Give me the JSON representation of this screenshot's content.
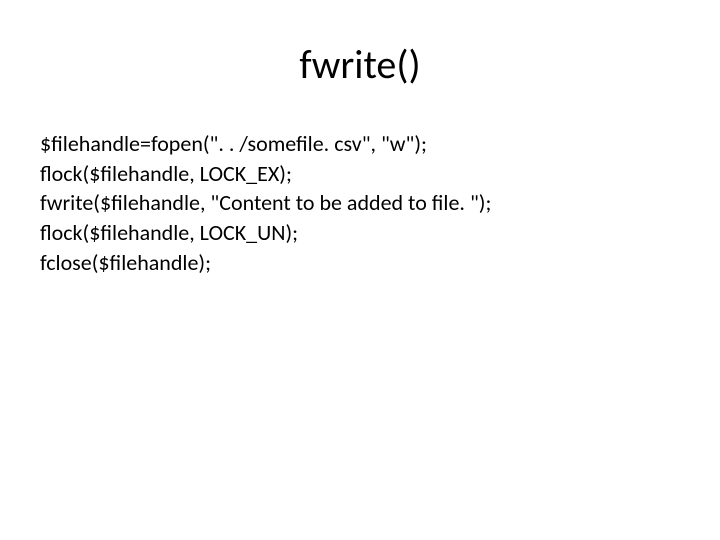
{
  "title": "fwrite()",
  "code": {
    "line1": "$filehandle=fopen(\". . /somefile. csv\", \"w\");",
    "line2": "flock($filehandle, LOCK_EX);",
    "line3": "fwrite($filehandle, \"Content to be added to file. \");",
    "line4": "flock($filehandle, LOCK_UN);",
    "line5": "fclose($filehandle);"
  }
}
